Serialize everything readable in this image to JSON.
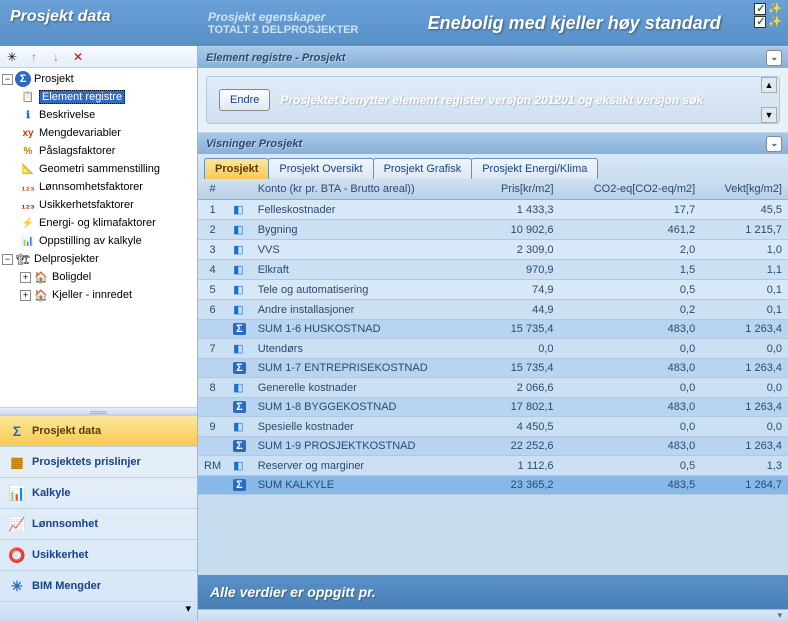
{
  "header": {
    "left_title": "Prosjekt data",
    "props_title": "Prosjekt egenskaper",
    "props_sub": "TOTALT 2 DELPROSJEKTER",
    "project_title": "Enebolig med kjeller høy standard"
  },
  "tree": {
    "root": "Prosjekt",
    "items": [
      "Element registre",
      "Beskrivelse",
      "Mengdevariabler",
      "Påslagsfaktorer",
      "Geometri sammenstilling",
      "Lønnsomhetsfaktorer",
      "Usikkerhetsfaktorer",
      "Energi- og klimafaktorer",
      "Oppstilling av kalkyle"
    ],
    "sub_root": "Delprosjekter",
    "sub_items": [
      "Boligdel",
      "Kjeller - innredet"
    ]
  },
  "nav": [
    "Prosjekt data",
    "Prosjektets prislinjer",
    "Kalkyle",
    "Lønnsomhet",
    "Usikkerhet",
    "BIM Mengder"
  ],
  "section1": {
    "title": "Element registre - Prosjekt",
    "button": "Endre",
    "text": "Prosjektet benytter element register versjon 201201 og eksakt versjon søk"
  },
  "section2": {
    "title": "Visninger Prosjekt"
  },
  "tabs": [
    "Prosjekt",
    "Prosjekt Oversikt",
    "Prosjekt Grafisk",
    "Prosjekt Energi/Klima"
  ],
  "columns": {
    "hash": "#",
    "konto": "Konto (kr pr. BTA - Brutto areal))",
    "pris": "Pris[kr/m2]",
    "co2": "CO2-eq[CO2-eq/m2]",
    "vekt": "Vekt[kg/m2]"
  },
  "rows": [
    {
      "n": "1",
      "label": "Felleskostnader",
      "pris": "1 433,3",
      "co2": "17,7",
      "vekt": "45,5",
      "type": "data"
    },
    {
      "n": "2",
      "label": "Bygning",
      "pris": "10 902,6",
      "co2": "461,2",
      "vekt": "1 215,7",
      "type": "data"
    },
    {
      "n": "3",
      "label": "VVS",
      "pris": "2 309,0",
      "co2": "2,0",
      "vekt": "1,0",
      "type": "data"
    },
    {
      "n": "4",
      "label": "Elkraft",
      "pris": "970,9",
      "co2": "1,5",
      "vekt": "1,1",
      "type": "data"
    },
    {
      "n": "5",
      "label": "Tele og automatisering",
      "pris": "74,9",
      "co2": "0,5",
      "vekt": "0,1",
      "type": "data"
    },
    {
      "n": "6",
      "label": "Andre installasjoner",
      "pris": "44,9",
      "co2": "0,2",
      "vekt": "0,1",
      "type": "data"
    },
    {
      "n": "",
      "label": "SUM 1-6 HUSKOSTNAD",
      "pris": "15 735,4",
      "co2": "483,0",
      "vekt": "1 263,4",
      "type": "sum"
    },
    {
      "n": "7",
      "label": "Utendørs",
      "pris": "0,0",
      "co2": "0,0",
      "vekt": "0,0",
      "type": "data"
    },
    {
      "n": "",
      "label": "SUM 1-7 ENTREPRISEKOSTNAD",
      "pris": "15 735,4",
      "co2": "483,0",
      "vekt": "1 263,4",
      "type": "sum"
    },
    {
      "n": "8",
      "label": "Generelle kostnader",
      "pris": "2 066,6",
      "co2": "0,0",
      "vekt": "0,0",
      "type": "data"
    },
    {
      "n": "",
      "label": "SUM 1-8 BYGGEKOSTNAD",
      "pris": "17 802,1",
      "co2": "483,0",
      "vekt": "1 263,4",
      "type": "sum"
    },
    {
      "n": "9",
      "label": "Spesielle kostnader",
      "pris": "4 450,5",
      "co2": "0,0",
      "vekt": "0,0",
      "type": "data"
    },
    {
      "n": "",
      "label": "SUM 1-9 PROSJEKTKOSTNAD",
      "pris": "22 252,6",
      "co2": "483,0",
      "vekt": "1 263,4",
      "type": "sum"
    },
    {
      "n": "RM",
      "label": "Reserver og marginer",
      "pris": "1 112,6",
      "co2": "0,5",
      "vekt": "1,3",
      "type": "data"
    },
    {
      "n": "",
      "label": "SUM KALKYLE",
      "pris": "23 365,2",
      "co2": "483,5",
      "vekt": "1 264,7",
      "type": "grand"
    }
  ],
  "footer": "Alle verdier er oppgitt pr."
}
